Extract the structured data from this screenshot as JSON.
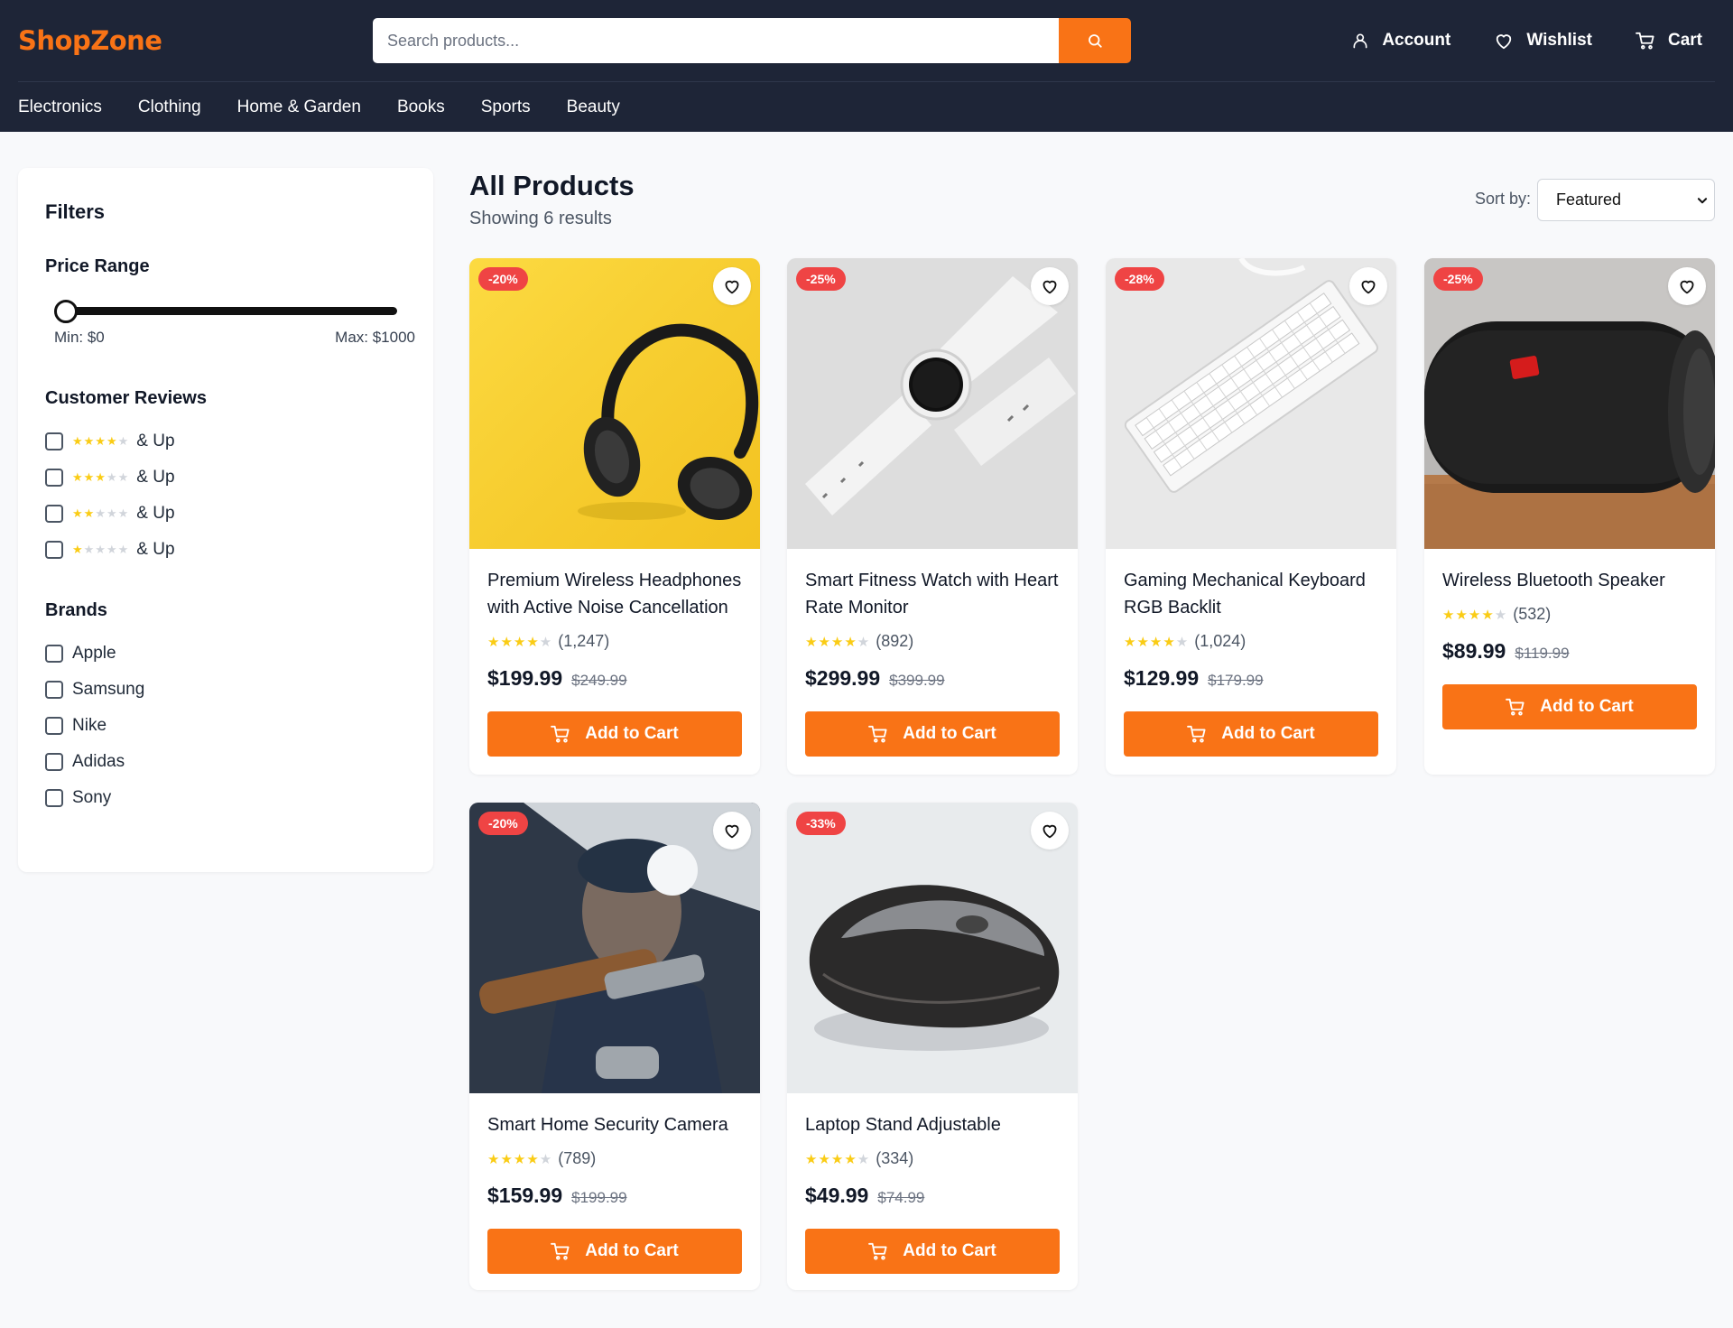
{
  "header": {
    "logo": "ShopZone",
    "search_placeholder": "Search products...",
    "actions": {
      "account": "Account",
      "wishlist": "Wishlist",
      "cart": "Cart"
    },
    "categories": [
      "Electronics",
      "Clothing",
      "Home & Garden",
      "Books",
      "Sports",
      "Beauty"
    ]
  },
  "filters": {
    "title": "Filters",
    "price_range": {
      "label": "Price Range",
      "min_label": "Min: $0",
      "max_label": "Max: $1000",
      "value": 0
    },
    "reviews": {
      "label": "Customer Reviews",
      "options": [
        {
          "stars": 4,
          "suffix": "& Up"
        },
        {
          "stars": 3,
          "suffix": "& Up"
        },
        {
          "stars": 2,
          "suffix": "& Up"
        },
        {
          "stars": 1,
          "suffix": "& Up"
        }
      ]
    },
    "brands": {
      "label": "Brands",
      "options": [
        "Apple",
        "Samsung",
        "Nike",
        "Adidas",
        "Sony"
      ]
    }
  },
  "main": {
    "title": "All Products",
    "results_text": "Showing 6 results",
    "sort_label": "Sort by:",
    "sort_value": "Featured",
    "add_to_cart_label": "Add to Cart",
    "products": [
      {
        "name": "Premium Wireless Headphones with Active Noise Cancellation",
        "badge": "-20%",
        "rating": 4,
        "reviews": "(1,247)",
        "price": "$199.99",
        "old_price": "$249.99"
      },
      {
        "name": "Smart Fitness Watch with Heart Rate Monitor",
        "badge": "-25%",
        "rating": 4,
        "reviews": "(892)",
        "price": "$299.99",
        "old_price": "$399.99"
      },
      {
        "name": "Gaming Mechanical Keyboard RGB Backlit",
        "badge": "-28%",
        "rating": 4,
        "reviews": "(1,024)",
        "price": "$129.99",
        "old_price": "$179.99"
      },
      {
        "name": "Wireless Bluetooth Speaker",
        "badge": "-25%",
        "rating": 4,
        "reviews": "(532)",
        "price": "$89.99",
        "old_price": "$119.99"
      },
      {
        "name": "Smart Home Security Camera",
        "badge": "-20%",
        "rating": 4,
        "reviews": "(789)",
        "price": "$159.99",
        "old_price": "$199.99"
      },
      {
        "name": "Laptop Stand Adjustable",
        "badge": "-33%",
        "rating": 4,
        "reviews": "(334)",
        "price": "$49.99",
        "old_price": "$74.99"
      }
    ]
  },
  "colors": {
    "accent": "#f97316",
    "header_bg": "#1e2537",
    "badge": "#ef4444",
    "star": "#facc15"
  }
}
